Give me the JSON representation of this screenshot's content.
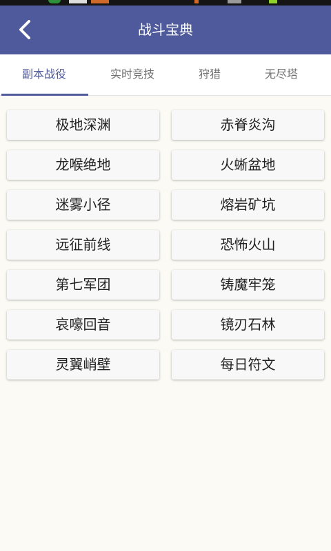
{
  "header": {
    "title": "战斗宝典",
    "back_icon": "chevron-left-icon",
    "color": "#4f5a9c"
  },
  "tabs": [
    {
      "label": "副本战役",
      "active": true
    },
    {
      "label": "实时竞技",
      "active": false
    },
    {
      "label": "狩猎",
      "active": false
    },
    {
      "label": "无尽塔",
      "active": false
    }
  ],
  "buttons": [
    "极地深渊",
    "赤脊炎沟",
    "龙喉绝地",
    "火蜥盆地",
    "迷雾小径",
    "熔岩矿坑",
    "远征前线",
    "恐怖火山",
    "第七军团",
    "铸魔牢笼",
    "哀嚎回音",
    "镜刃石林",
    "灵翼峭壁",
    "每日符文"
  ],
  "colors": {
    "accent": "#4f5a9c",
    "background": "#fbfaf4",
    "button": "#f8f8f8"
  }
}
